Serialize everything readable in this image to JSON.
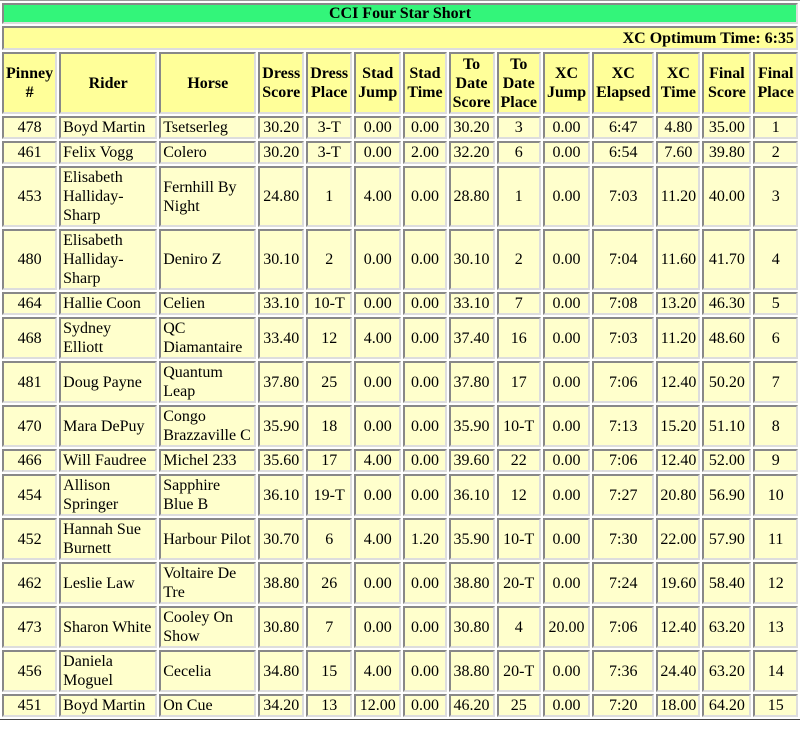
{
  "title": "CCI Four Star Short",
  "optimum_time": "XC Optimum Time: 6:35",
  "columns": [
    "Pinney #",
    "Rider",
    "Horse",
    "Dress Score",
    "Dress Place",
    "Stad Jump",
    "Stad Time",
    "To Date Score",
    "To Date Place",
    "XC Jump",
    "XC Elapsed",
    "XC Time",
    "Final Score",
    "Final Place"
  ],
  "colors": {
    "title_bg": "#33f57a",
    "header_bg": "#ffff99",
    "cell_bg": "#ffffcc"
  },
  "rows": [
    [
      "478",
      "Boyd Martin",
      "Tsetserleg",
      "30.20",
      "3-T",
      "0.00",
      "0.00",
      "30.20",
      "3",
      "0.00",
      "6:47",
      "4.80",
      "35.00",
      "1"
    ],
    [
      "461",
      "Felix Vogg",
      "Colero",
      "30.20",
      "3-T",
      "0.00",
      "2.00",
      "32.20",
      "6",
      "0.00",
      "6:54",
      "7.60",
      "39.80",
      "2"
    ],
    [
      "453",
      "Elisabeth Halliday-Sharp",
      "Fernhill By Night",
      "24.80",
      "1",
      "4.00",
      "0.00",
      "28.80",
      "1",
      "0.00",
      "7:03",
      "11.20",
      "40.00",
      "3"
    ],
    [
      "480",
      "Elisabeth Halliday-Sharp",
      "Deniro Z",
      "30.10",
      "2",
      "0.00",
      "0.00",
      "30.10",
      "2",
      "0.00",
      "7:04",
      "11.60",
      "41.70",
      "4"
    ],
    [
      "464",
      "Hallie Coon",
      "Celien",
      "33.10",
      "10-T",
      "0.00",
      "0.00",
      "33.10",
      "7",
      "0.00",
      "7:08",
      "13.20",
      "46.30",
      "5"
    ],
    [
      "468",
      "Sydney Elliott",
      "QC Diamantaire",
      "33.40",
      "12",
      "4.00",
      "0.00",
      "37.40",
      "16",
      "0.00",
      "7:03",
      "11.20",
      "48.60",
      "6"
    ],
    [
      "481",
      "Doug Payne",
      "Quantum Leap",
      "37.80",
      "25",
      "0.00",
      "0.00",
      "37.80",
      "17",
      "0.00",
      "7:06",
      "12.40",
      "50.20",
      "7"
    ],
    [
      "470",
      "Mara DePuy",
      "Congo Brazzaville C",
      "35.90",
      "18",
      "0.00",
      "0.00",
      "35.90",
      "10-T",
      "0.00",
      "7:13",
      "15.20",
      "51.10",
      "8"
    ],
    [
      "466",
      "Will Faudree",
      "Michel 233",
      "35.60",
      "17",
      "4.00",
      "0.00",
      "39.60",
      "22",
      "0.00",
      "7:06",
      "12.40",
      "52.00",
      "9"
    ],
    [
      "454",
      "Allison Springer",
      "Sapphire Blue B",
      "36.10",
      "19-T",
      "0.00",
      "0.00",
      "36.10",
      "12",
      "0.00",
      "7:27",
      "20.80",
      "56.90",
      "10"
    ],
    [
      "452",
      "Hannah Sue Burnett",
      "Harbour Pilot",
      "30.70",
      "6",
      "4.00",
      "1.20",
      "35.90",
      "10-T",
      "0.00",
      "7:30",
      "22.00",
      "57.90",
      "11"
    ],
    [
      "462",
      "Leslie Law",
      "Voltaire De Tre",
      "38.80",
      "26",
      "0.00",
      "0.00",
      "38.80",
      "20-T",
      "0.00",
      "7:24",
      "19.60",
      "58.40",
      "12"
    ],
    [
      "473",
      "Sharon White",
      "Cooley On Show",
      "30.80",
      "7",
      "0.00",
      "0.00",
      "30.80",
      "4",
      "20.00",
      "7:06",
      "12.40",
      "63.20",
      "13"
    ],
    [
      "456",
      "Daniela Moguel",
      "Cecelia",
      "34.80",
      "15",
      "4.00",
      "0.00",
      "38.80",
      "20-T",
      "0.00",
      "7:36",
      "24.40",
      "63.20",
      "14"
    ],
    [
      "451",
      "Boyd Martin",
      "On Cue",
      "34.20",
      "13",
      "12.00",
      "0.00",
      "46.20",
      "25",
      "0.00",
      "7:20",
      "18.00",
      "64.20",
      "15"
    ]
  ]
}
